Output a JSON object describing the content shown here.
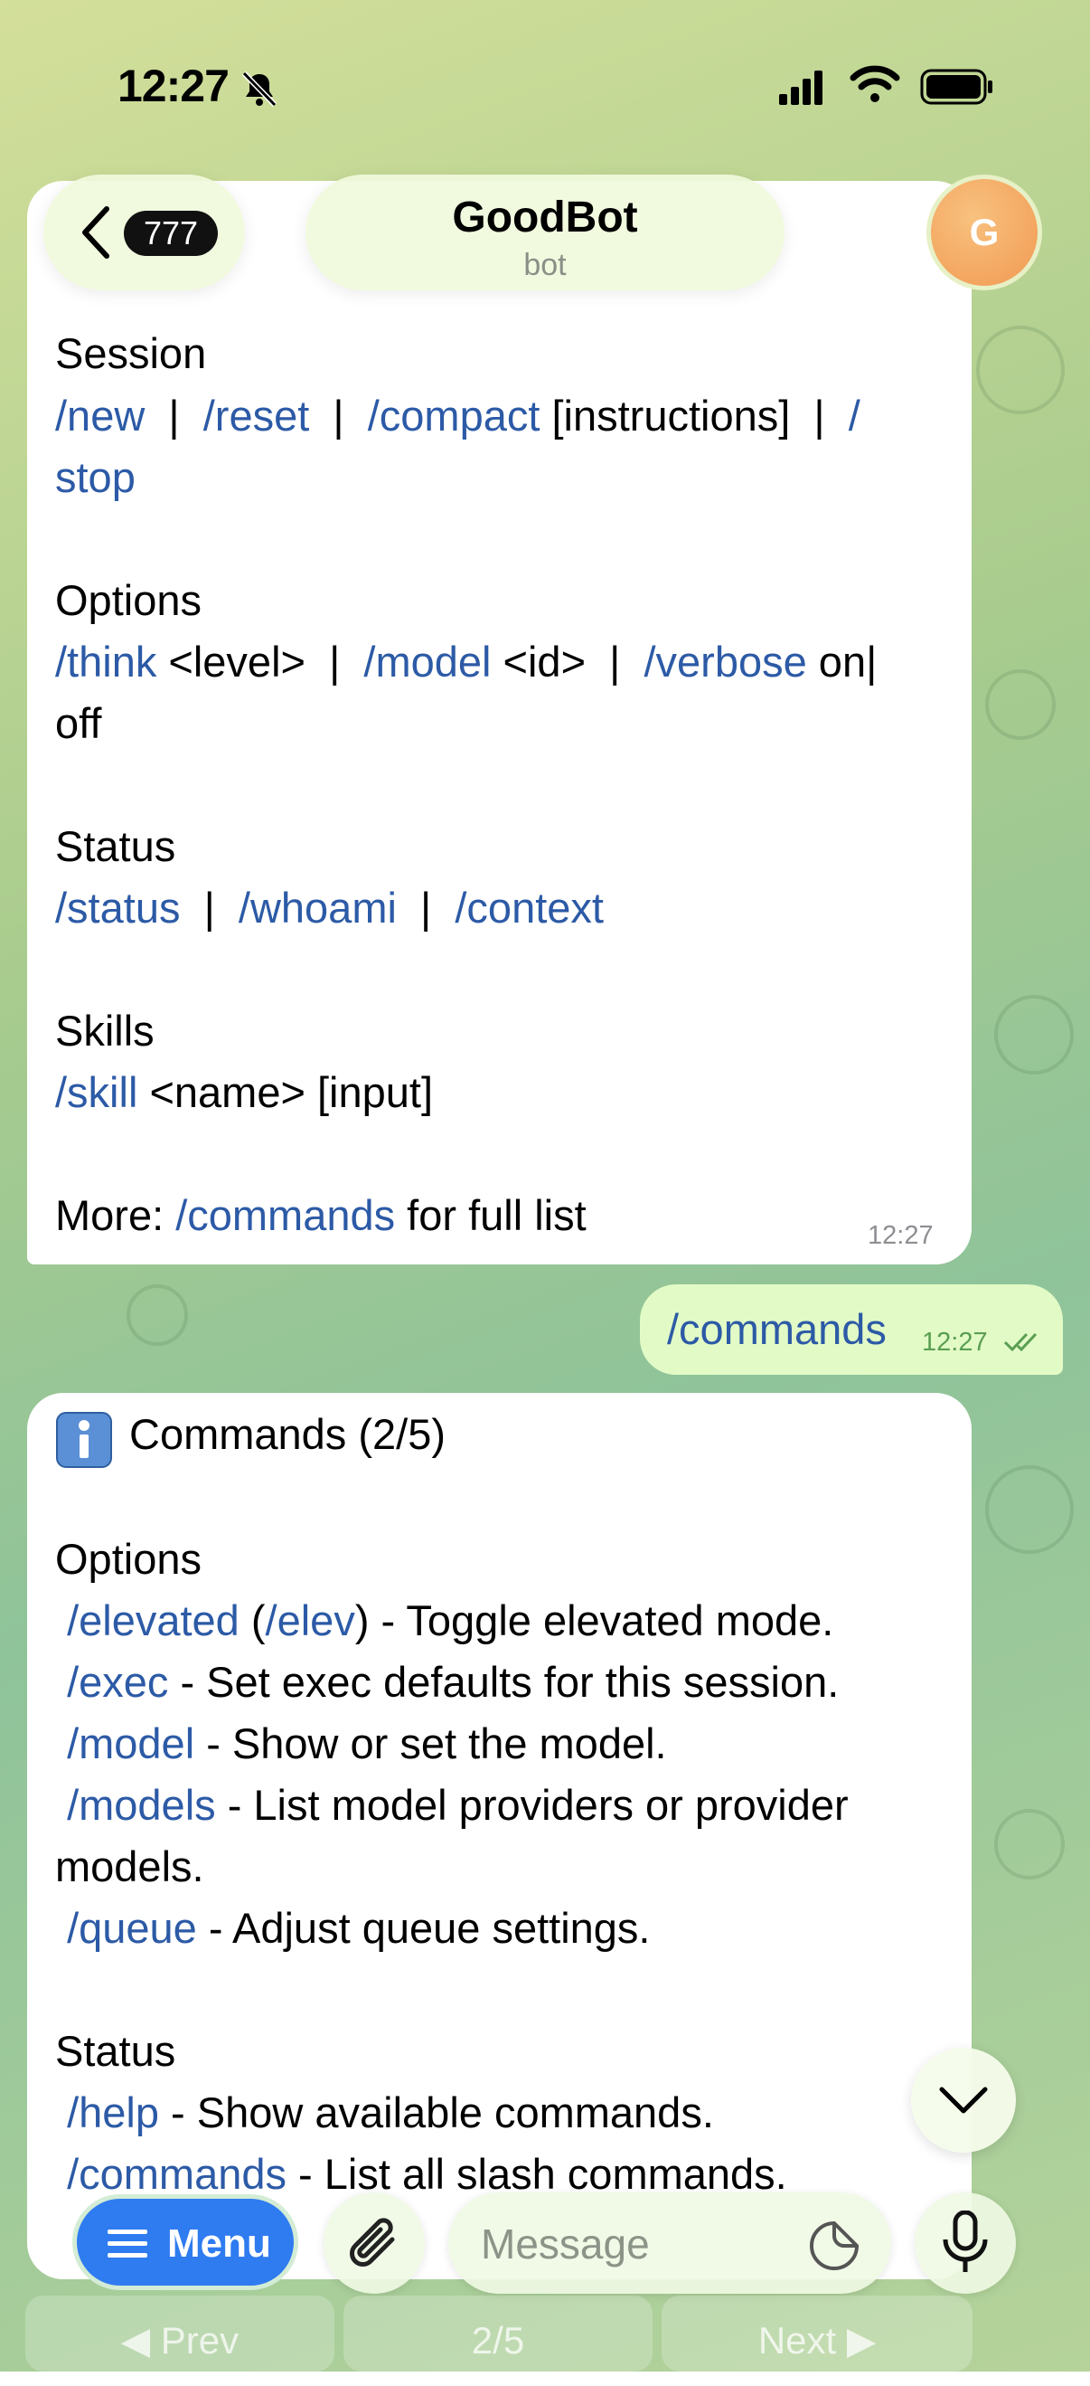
{
  "status_bar": {
    "time": "12:27"
  },
  "header": {
    "back_count": "777",
    "title": "GoodBot",
    "subtitle": "bot",
    "avatar_letter": "G"
  },
  "message1": {
    "lines": [
      {
        "parts": [
          {
            "t": "Session",
            "c": false
          }
        ]
      },
      {
        "parts": [
          {
            "t": "/new",
            "c": true
          },
          {
            "t": "  |  ",
            "c": false
          },
          {
            "t": "/reset",
            "c": true
          },
          {
            "t": "  |  ",
            "c": false
          },
          {
            "t": "/compact",
            "c": true
          },
          {
            "t": " [instructions]  |  ",
            "c": false
          },
          {
            "t": "/",
            "c": true
          }
        ]
      },
      {
        "parts": [
          {
            "t": "stop",
            "c": true
          }
        ]
      },
      {
        "parts": [
          {
            "t": "Options",
            "c": false
          }
        ]
      },
      {
        "parts": [
          {
            "t": "/think",
            "c": true
          },
          {
            "t": " <level>  |  ",
            "c": false
          },
          {
            "t": "/model",
            "c": true
          },
          {
            "t": " <id>  |  ",
            "c": false
          },
          {
            "t": "/verbose",
            "c": true
          },
          {
            "t": " on|",
            "c": false
          }
        ]
      },
      {
        "parts": [
          {
            "t": "off",
            "c": false
          }
        ]
      },
      {
        "parts": [
          {
            "t": "Status",
            "c": false
          }
        ]
      },
      {
        "parts": [
          {
            "t": "/status",
            "c": true
          },
          {
            "t": "  |  ",
            "c": false
          },
          {
            "t": "/whoami",
            "c": true
          },
          {
            "t": "  |  ",
            "c": false
          },
          {
            "t": "/context",
            "c": true
          }
        ]
      },
      {
        "parts": [
          {
            "t": "Skills",
            "c": false
          }
        ]
      },
      {
        "parts": [
          {
            "t": "/skill",
            "c": true
          },
          {
            "t": " <name> [input]",
            "c": false
          }
        ]
      },
      {
        "parts": [
          {
            "t": "More: ",
            "c": false
          },
          {
            "t": "/commands",
            "c": true
          },
          {
            "t": " for full list",
            "c": false
          }
        ]
      }
    ],
    "time": "12:27"
  },
  "outgoing": {
    "text": "/commands",
    "time": "12:27"
  },
  "message2": {
    "lines": [
      {
        "parts": [
          {
            "t": "Commands (2/5)",
            "c": false
          }
        ]
      },
      {
        "parts": [
          {
            "t": "Options",
            "c": false
          }
        ]
      },
      {
        "parts": [
          {
            "t": " ",
            "c": false
          },
          {
            "t": "/elevated",
            "c": true
          },
          {
            "t": " (",
            "c": false
          },
          {
            "t": "/elev",
            "c": true
          },
          {
            "t": ") - Toggle elevated mode.",
            "c": false
          }
        ]
      },
      {
        "parts": [
          {
            "t": " ",
            "c": false
          },
          {
            "t": "/exec",
            "c": true
          },
          {
            "t": " - Set exec defaults for this session.",
            "c": false
          }
        ]
      },
      {
        "parts": [
          {
            "t": " ",
            "c": false
          },
          {
            "t": "/model",
            "c": true
          },
          {
            "t": " - Show or set the model.",
            "c": false
          }
        ]
      },
      {
        "parts": [
          {
            "t": " ",
            "c": false
          },
          {
            "t": "/models",
            "c": true
          },
          {
            "t": " - List model providers or provider",
            "c": false
          }
        ]
      },
      {
        "parts": [
          {
            "t": "models.",
            "c": false
          }
        ]
      },
      {
        "parts": [
          {
            "t": " ",
            "c": false
          },
          {
            "t": "/queue",
            "c": true
          },
          {
            "t": " - Adjust queue settings.",
            "c": false
          }
        ]
      },
      {
        "parts": [
          {
            "t": "Status",
            "c": false
          }
        ]
      },
      {
        "parts": [
          {
            "t": " ",
            "c": false
          },
          {
            "t": "/help",
            "c": true
          },
          {
            "t": " - Show available commands.",
            "c": false
          }
        ]
      },
      {
        "parts": [
          {
            "t": " ",
            "c": false
          },
          {
            "t": "/commands",
            "c": true
          },
          {
            "t": " - List all slash commands.",
            "c": false
          }
        ]
      }
    ]
  },
  "input": {
    "menu_label": "Menu",
    "placeholder": "Message"
  },
  "pager": {
    "prev": "◀ Prev",
    "page": "2/5",
    "next": "Next ▶"
  },
  "colors": {
    "link": "#2c5aa6",
    "menu": "#2f7bf0",
    "outgoing_bubble": "#e2fbc6"
  },
  "icons": [
    "bell-slash-icon",
    "signal-icon",
    "wifi-icon",
    "battery-icon",
    "chevron-left-icon",
    "info-icon",
    "chevron-down-icon",
    "menu-lines-icon",
    "paperclip-icon",
    "sticker-icon",
    "microphone-icon",
    "double-check-icon"
  ]
}
